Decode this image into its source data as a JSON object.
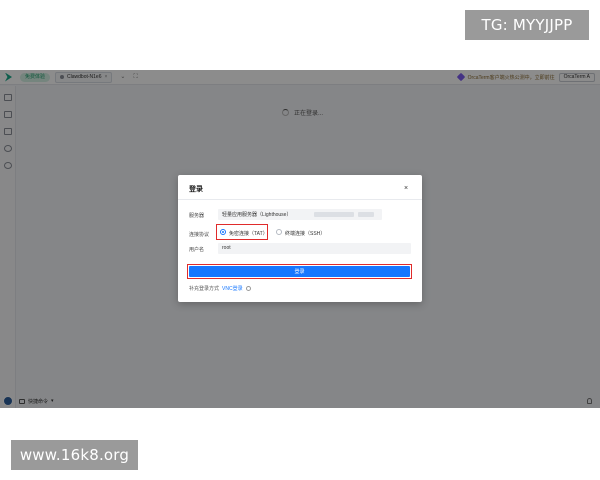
{
  "watermarks": {
    "top": "TG: MYYJJPP",
    "bottom": "www.16k8.org"
  },
  "tabbar": {
    "tag_label": "免费体验",
    "tab_label": "Clawdbot-N1e6",
    "promo_text": "OrcaTerm客户端火热公测中，立即前往",
    "orca_button": "OrcaTerm A"
  },
  "main": {
    "loading_text": "正在登录..."
  },
  "bottombar": {
    "quick_cmd": "快捷命令"
  },
  "modal": {
    "title": "登录",
    "close": "×",
    "server_label": "服务器",
    "server_value": "轻量应用服务器（Lighthouse）",
    "protocol_label": "连接协议",
    "protocol_options": [
      "免密连接（TAT）",
      "终端连接（SSH）"
    ],
    "username_label": "用户名",
    "username_value": "root",
    "login_button": "登录",
    "supplement_label": "补充登录方式",
    "supplement_link": "VNC登录"
  },
  "colors": {
    "primary": "#1677ff",
    "highlight": "#e02b2b",
    "accent_green": "#1aaa8a"
  },
  "icons": [
    "logo-icon",
    "chevron-down-icon",
    "fullscreen-icon",
    "sparkle-icon",
    "server-icon",
    "terminal-icon",
    "file-icon",
    "home-icon",
    "cloud-icon",
    "spinner-icon",
    "info-icon",
    "close-icon",
    "bell-icon",
    "avatar-icon"
  ]
}
